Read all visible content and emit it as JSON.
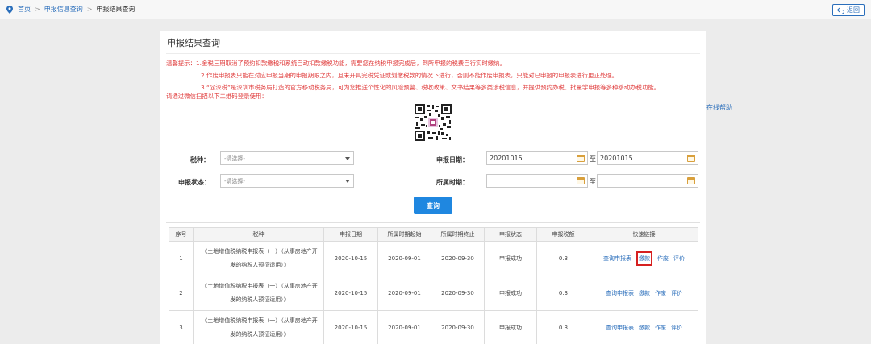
{
  "breadcrumb": {
    "home": "首页",
    "level2": "申报信息查询",
    "current": "申报结果查询"
  },
  "back_label": "返回",
  "side_link": "在线帮助",
  "panel": {
    "title": "申报结果查询",
    "tips": [
      "温馨提示：1.金税三期取消了预约扣款缴税和系统自动扣款缴税功能，需要您在纳税申报完成后，到所申报的税费自行实时缴纳。",
      "2.作废申报表只能在对应申报当期的申报期限之内，且未开具完税凭证或划缴税款的情况下进行，否则不能作废申报表，只能对已申报的申报表进行更正处理。",
      "3.“@深税”是深圳市税务局打造的官方移动税务局，可为您推送个性化的风险预警、税收政策、文书结果等多类涉税信息，并提供预约办税、批量学申报等多种移动办税功能。",
      "请通过微信扫描以下二维码登录使用："
    ]
  },
  "form": {
    "tax_type_label": "税种：",
    "tax_type_value": "-请选择-",
    "status_label": "申报状态：",
    "status_value": "-请选择-",
    "declare_date_label": "申报日期：",
    "declare_date_from": "20201015",
    "declare_date_to": "20201015",
    "period_label": "所属时期：",
    "period_from": "",
    "period_to": "",
    "to_label": "至",
    "query_label": "查询"
  },
  "table": {
    "headers": [
      "序号",
      "税种",
      "申报日期",
      "所属时期起始",
      "所属时期终止",
      "申报状态",
      "申报税额",
      "快速链接"
    ],
    "rows": [
      {
        "seq": "1",
        "tax": "《土地增值税纳税申报表（一）（从事房地产开发的纳税人预征适用）》",
        "date": "2020-10-15",
        "start": "2020-09-01",
        "end": "2020-09-30",
        "status": "申报成功",
        "amount": "0.3"
      },
      {
        "seq": "2",
        "tax": "《土地增值税纳税申报表（一）（从事房地产开发的纳税人预征适用）》",
        "date": "2020-10-15",
        "start": "2020-09-01",
        "end": "2020-09-30",
        "status": "申报成功",
        "amount": "0.3"
      },
      {
        "seq": "3",
        "tax": "《土地增值税纳税申报表（一）（从事房地产开发的纳税人预征适用）》",
        "date": "2020-10-15",
        "start": "2020-09-01",
        "end": "2020-09-30",
        "status": "申报成功",
        "amount": "0.3"
      }
    ],
    "links": {
      "view": "查询申报表",
      "pay": "缴款",
      "void": "作废",
      "rate": "评价"
    }
  }
}
